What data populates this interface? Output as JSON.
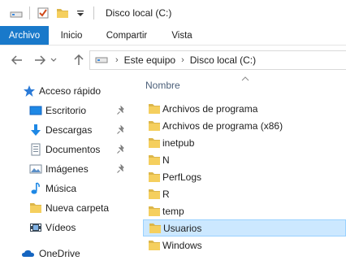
{
  "window": {
    "title": "Disco local (C:)"
  },
  "quick_access_toolbar": {
    "items": [
      "drive-icon",
      "properties-check-icon",
      "new-folder-icon",
      "customize-dropdown-icon"
    ]
  },
  "ribbon": {
    "tabs": [
      {
        "label": "Archivo",
        "active": true
      },
      {
        "label": "Inicio"
      },
      {
        "label": "Compartir"
      },
      {
        "label": "Vista"
      }
    ]
  },
  "address_bar": {
    "crumbs": [
      "Este equipo",
      "Disco local (C:)"
    ]
  },
  "sidebar": {
    "items": [
      {
        "label": "Acceso rápido",
        "icon": "star-icon"
      },
      {
        "label": "Escritorio",
        "icon": "desktop-icon",
        "pinned": true
      },
      {
        "label": "Descargas",
        "icon": "download-icon",
        "pinned": true
      },
      {
        "label": "Documentos",
        "icon": "documents-icon",
        "pinned": true
      },
      {
        "label": "Imágenes",
        "icon": "pictures-icon",
        "pinned": true
      },
      {
        "label": "Música",
        "icon": "music-icon"
      },
      {
        "label": "Nueva carpeta",
        "icon": "folder-icon"
      },
      {
        "label": "Vídeos",
        "icon": "videos-icon"
      },
      {
        "label": "OneDrive",
        "icon": "cloud-icon"
      }
    ]
  },
  "file_list": {
    "column_header": "Nombre",
    "rows": [
      {
        "name": "Archivos de programa"
      },
      {
        "name": "Archivos de programa (x86)"
      },
      {
        "name": "inetpub"
      },
      {
        "name": "N"
      },
      {
        "name": "PerfLogs"
      },
      {
        "name": "R"
      },
      {
        "name": "temp"
      },
      {
        "name": "Usuarios",
        "selected": true
      },
      {
        "name": "Windows"
      }
    ]
  },
  "colors": {
    "accent": "#1979ca",
    "selection_bg": "#cce8ff",
    "selection_border": "#99d1ff",
    "folder": "#f5cf5e",
    "header_text": "#4c607a"
  }
}
